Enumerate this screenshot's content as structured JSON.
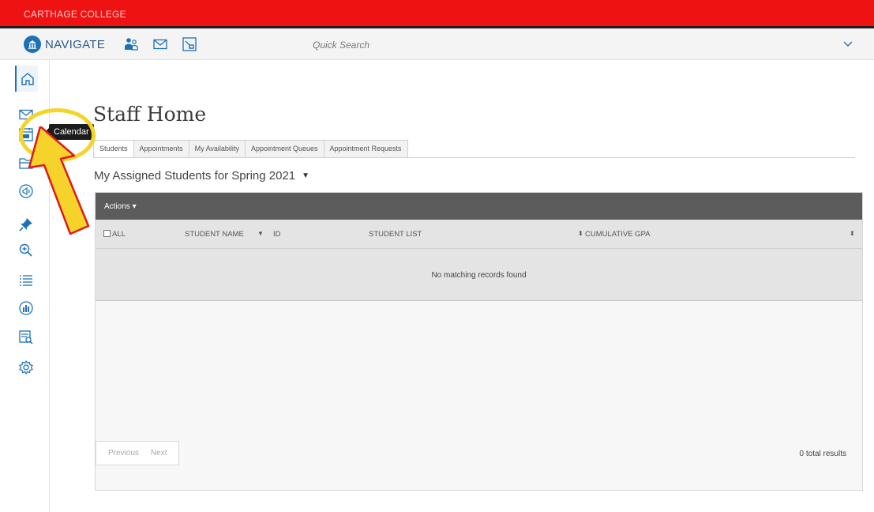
{
  "college": {
    "name": "CARTHAGE COLLEGE"
  },
  "header": {
    "app_name": "NAVIGATE",
    "search_placeholder": "Quick Search",
    "icons": [
      "navigate-logo-icon",
      "students-icon",
      "mail-icon",
      "report-icon",
      "chevron-down-icon"
    ]
  },
  "sidebar": {
    "items": [
      {
        "name": "home-icon"
      },
      {
        "name": "mail-icon"
      },
      {
        "name": "calendar-icon"
      },
      {
        "name": "folder-icon"
      },
      {
        "name": "megaphone-icon"
      },
      {
        "name": "pin-icon"
      },
      {
        "name": "zoom-icon"
      },
      {
        "name": "list-icon"
      },
      {
        "name": "analytics-icon"
      },
      {
        "name": "report-search-icon"
      },
      {
        "name": "settings-icon"
      }
    ],
    "tooltip": "Calendar"
  },
  "page": {
    "title": "Staff Home",
    "tabs": [
      "Students",
      "Appointments",
      "My Availability",
      "Appointment Queues",
      "Appointment Requests"
    ],
    "section_title": "My Assigned Students for Spring 2021"
  },
  "table": {
    "actions_label": "Actions",
    "columns": [
      "ALL",
      "STUDENT NAME",
      "ID",
      "STUDENT LIST",
      "CUMULATIVE GPA"
    ],
    "empty_message": "No matching records found",
    "pager": {
      "previous": "Previous",
      "next": "Next"
    },
    "total": "0 total results"
  },
  "colors": {
    "college_bar": "#ee1212",
    "brand_blue": "#1d71b8",
    "actions_bar": "#5c5c5c",
    "annotation_yellow": "#f6d32a",
    "annotation_outline": "#e01a1a"
  }
}
